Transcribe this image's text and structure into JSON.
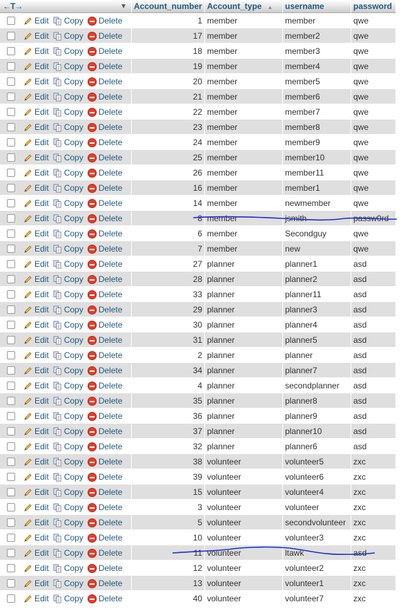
{
  "header": {
    "control_arrows": "←T→",
    "menu_caret": "▼",
    "sort_caret": "▲",
    "columns": [
      "Account_number",
      "Account_type",
      "username",
      "password"
    ]
  },
  "actions": {
    "edit_label": "Edit",
    "copy_label": "Copy",
    "delete_label": "Delete"
  },
  "rows": [
    {
      "account_number": "1",
      "account_type": "member",
      "username": "member",
      "password": "qwe"
    },
    {
      "account_number": "17",
      "account_type": "member",
      "username": "member2",
      "password": "qwe"
    },
    {
      "account_number": "18",
      "account_type": "member",
      "username": "member3",
      "password": "qwe"
    },
    {
      "account_number": "19",
      "account_type": "member",
      "username": "member4",
      "password": "qwe"
    },
    {
      "account_number": "20",
      "account_type": "member",
      "username": "member5",
      "password": "qwe"
    },
    {
      "account_number": "21",
      "account_type": "member",
      "username": "member6",
      "password": "qwe"
    },
    {
      "account_number": "22",
      "account_type": "member",
      "username": "member7",
      "password": "qwe"
    },
    {
      "account_number": "23",
      "account_type": "member",
      "username": "member8",
      "password": "qwe"
    },
    {
      "account_number": "24",
      "account_type": "member",
      "username": "member9",
      "password": "qwe"
    },
    {
      "account_number": "25",
      "account_type": "member",
      "username": "member10",
      "password": "qwe"
    },
    {
      "account_number": "26",
      "account_type": "member",
      "username": "member11",
      "password": "qwe"
    },
    {
      "account_number": "16",
      "account_type": "member",
      "username": "member1",
      "password": "qwe"
    },
    {
      "account_number": "14",
      "account_type": "member",
      "username": "newmember",
      "password": "qwe"
    },
    {
      "account_number": "8",
      "account_type": "member",
      "username": "jsmith",
      "password": "passw0rd"
    },
    {
      "account_number": "6",
      "account_type": "member",
      "username": "Secondguy",
      "password": "qwe"
    },
    {
      "account_number": "7",
      "account_type": "member",
      "username": "new",
      "password": "qwe"
    },
    {
      "account_number": "27",
      "account_type": "planner",
      "username": "planner1",
      "password": "asd"
    },
    {
      "account_number": "28",
      "account_type": "planner",
      "username": "planner2",
      "password": "asd"
    },
    {
      "account_number": "33",
      "account_type": "planner",
      "username": "planner11",
      "password": "asd"
    },
    {
      "account_number": "29",
      "account_type": "planner",
      "username": "planner3",
      "password": "asd"
    },
    {
      "account_number": "30",
      "account_type": "planner",
      "username": "planner4",
      "password": "asd"
    },
    {
      "account_number": "31",
      "account_type": "planner",
      "username": "planner5",
      "password": "asd"
    },
    {
      "account_number": "2",
      "account_type": "planner",
      "username": "planner",
      "password": "asd"
    },
    {
      "account_number": "34",
      "account_type": "planner",
      "username": "planner7",
      "password": "asd"
    },
    {
      "account_number": "4",
      "account_type": "planner",
      "username": "secondplanner",
      "password": "asd"
    },
    {
      "account_number": "35",
      "account_type": "planner",
      "username": "planner8",
      "password": "asd"
    },
    {
      "account_number": "36",
      "account_type": "planner",
      "username": "planner9",
      "password": "asd"
    },
    {
      "account_number": "37",
      "account_type": "planner",
      "username": "planner10",
      "password": "asd"
    },
    {
      "account_number": "32",
      "account_type": "planner",
      "username": "planner6",
      "password": "asd"
    },
    {
      "account_number": "38",
      "account_type": "volunteer",
      "username": "volunteer5",
      "password": "zxc"
    },
    {
      "account_number": "39",
      "account_type": "volunteer",
      "username": "volunteer6",
      "password": "zxc"
    },
    {
      "account_number": "15",
      "account_type": "volunteer",
      "username": "volunteer4",
      "password": "zxc"
    },
    {
      "account_number": "3",
      "account_type": "volunteer",
      "username": "volunteer",
      "password": "zxc"
    },
    {
      "account_number": "5",
      "account_type": "volunteer",
      "username": "secondvolunteer",
      "password": "zxc"
    },
    {
      "account_number": "10",
      "account_type": "volunteer",
      "username": "volunteer3",
      "password": "zxc"
    },
    {
      "account_number": "11",
      "account_type": "volunteer",
      "username": "ltawk",
      "password": "asd"
    },
    {
      "account_number": "12",
      "account_type": "volunteer",
      "username": "volunteer2",
      "password": "zxc"
    },
    {
      "account_number": "13",
      "account_type": "volunteer",
      "username": "volunteer1",
      "password": "zxc"
    },
    {
      "account_number": "40",
      "account_type": "volunteer",
      "username": "volunteer7",
      "password": "zxc"
    }
  ],
  "colors": {
    "link": "#235a81",
    "row_even": "#dfdfdf",
    "scribble": "#1a2fd6",
    "delete_icon": "#e4402b"
  }
}
